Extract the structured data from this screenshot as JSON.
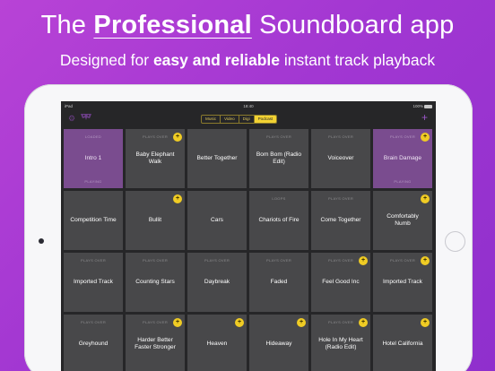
{
  "promo": {
    "headline_pre": "The",
    "headline_highlight": "Professional",
    "headline_post": "Soundboard app",
    "subline_pre": "Designed for",
    "subline_highlight": "easy and reliable",
    "subline_post": "instant track playback"
  },
  "status_bar": {
    "device": "iPad",
    "time": "18:40",
    "battery": "100%"
  },
  "toolbar": {
    "tabs": [
      "Music",
      "Video",
      "Digi",
      "Podcast"
    ],
    "active_tab": "Podcast",
    "settings_icon": "gear-icon",
    "logo_icon": "mask-logo-icon",
    "add_icon": "plus-icon"
  },
  "colors": {
    "background": "#a237d2",
    "tile": "#48484a",
    "tile_selected": "#7a4c8f",
    "accent": "#f2d233"
  },
  "tiles": [
    {
      "label": "Intro 1",
      "status": "LOADED",
      "status_bottom": "PLAYING",
      "selected": true,
      "badge": false
    },
    {
      "label": "Baby Elephant Walk",
      "status": "PLAYS OVER",
      "selected": false,
      "badge": true
    },
    {
      "label": "Better Together",
      "status": "",
      "selected": false,
      "badge": false
    },
    {
      "label": "Bom Bom (Radio Edit)",
      "status": "PLAYS OVER",
      "selected": false,
      "badge": false
    },
    {
      "label": "Voiceover",
      "status": "PLAYS OVER",
      "selected": false,
      "badge": false
    },
    {
      "label": "Brain Damage",
      "status": "PLAYS OVER",
      "status_bottom": "PLAYING",
      "selected": true,
      "badge": true
    },
    {
      "label": "Competition Time",
      "status": "",
      "selected": false,
      "badge": false
    },
    {
      "label": "Bullit",
      "status": "",
      "selected": false,
      "badge": true
    },
    {
      "label": "Cars",
      "status": "",
      "selected": false,
      "badge": false
    },
    {
      "label": "Chariots of Fire",
      "status": "LOOPS",
      "selected": false,
      "badge": false
    },
    {
      "label": "Come Together",
      "status": "PLAYS OVER",
      "selected": false,
      "badge": false
    },
    {
      "label": "Comfortably Numb",
      "status": "",
      "selected": false,
      "badge": true
    },
    {
      "label": "Imported Track",
      "status": "PLAYS OVER",
      "selected": false,
      "badge": false
    },
    {
      "label": "Counting Stars",
      "status": "PLAYS OVER",
      "selected": false,
      "badge": false
    },
    {
      "label": "Daybreak",
      "status": "PLAYS OVER",
      "selected": false,
      "badge": false
    },
    {
      "label": "Faded",
      "status": "PLAYS OVER",
      "selected": false,
      "badge": false
    },
    {
      "label": "Feel Good Inc",
      "status": "PLAYS OVER",
      "selected": false,
      "badge": true
    },
    {
      "label": "Imported Track",
      "status": "PLAYS OVER",
      "selected": false,
      "badge": true
    },
    {
      "label": "Greyhound",
      "status": "PLAYS OVER",
      "selected": false,
      "badge": false
    },
    {
      "label": "Harder Better Faster Stronger",
      "status": "PLAYS OVER",
      "selected": false,
      "badge": true
    },
    {
      "label": "Heaven",
      "status": "",
      "selected": false,
      "badge": true
    },
    {
      "label": "Hideaway",
      "status": "",
      "selected": false,
      "badge": true
    },
    {
      "label": "Hole In My Heart (Radio Edit)",
      "status": "PLAYS OVER",
      "selected": false,
      "badge": true
    },
    {
      "label": "Hotel California",
      "status": "",
      "selected": false,
      "badge": true
    }
  ]
}
